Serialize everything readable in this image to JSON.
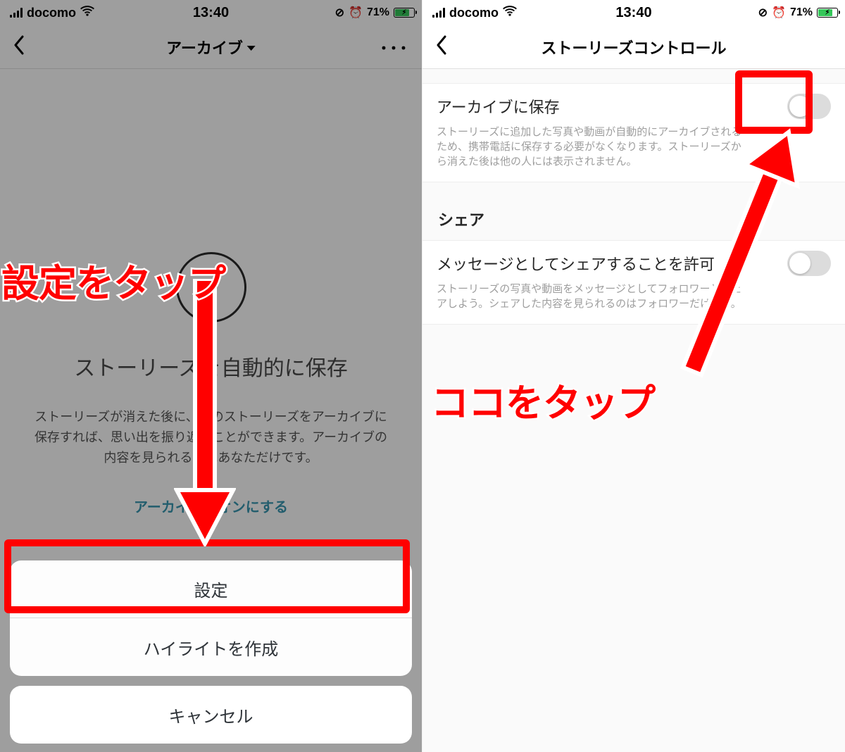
{
  "status": {
    "carrier": "docomo",
    "time": "13:40",
    "battery_pct": "71%"
  },
  "left": {
    "nav_title": "アーカイブ",
    "body_heading": "ストーリーズを自動的に保存",
    "body_desc": "ストーリーズが消えた後に、そのストーリーズをアーカイブに保存すれば、思い出を振り返ることができます。アーカイブの内容を見られるのはあなただけです。",
    "body_link": "アーカイブをオンにする",
    "sheet": {
      "settings": "設定",
      "highlight": "ハイライトを作成",
      "cancel": "キャンセル"
    },
    "annotation": "設定をタップ"
  },
  "right": {
    "nav_title": "ストーリーズコントロール",
    "archive": {
      "title": "アーカイブに保存",
      "desc": "ストーリーズに追加した写真や動画が自動的にアーカイブされるため、携帯電話に保存する必要がなくなります。ストーリーズから消えた後は他の人には表示されません。"
    },
    "share_header": "シェア",
    "share_msg": {
      "title": "メッセージとしてシェアすることを許可",
      "desc": "ストーリーズの写真や動画をメッセージとしてフォロワーとシェアしよう。シェアした内容を見られるのはフォロワーだけです。"
    },
    "annotation": "ココをタップ"
  }
}
